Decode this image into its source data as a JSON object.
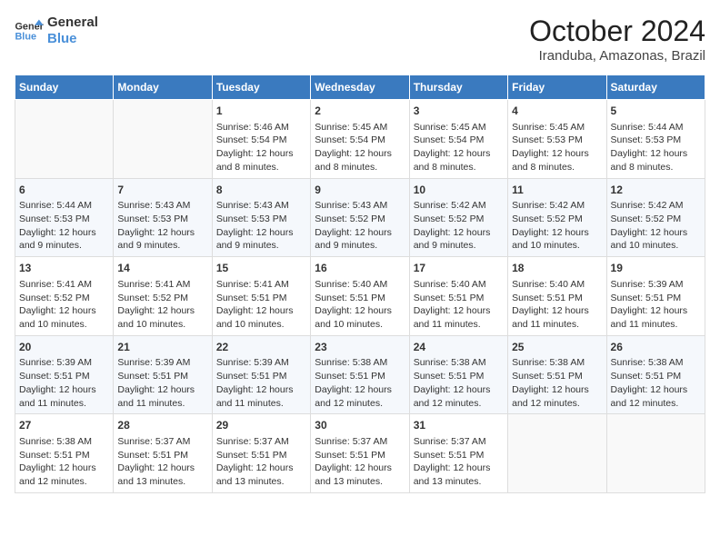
{
  "header": {
    "logo_line1": "General",
    "logo_line2": "Blue",
    "month": "October 2024",
    "location": "Iranduba, Amazonas, Brazil"
  },
  "weekdays": [
    "Sunday",
    "Monday",
    "Tuesday",
    "Wednesday",
    "Thursday",
    "Friday",
    "Saturday"
  ],
  "weeks": [
    [
      {
        "day": "",
        "info": ""
      },
      {
        "day": "",
        "info": ""
      },
      {
        "day": "1",
        "info": "Sunrise: 5:46 AM\nSunset: 5:54 PM\nDaylight: 12 hours and 8 minutes."
      },
      {
        "day": "2",
        "info": "Sunrise: 5:45 AM\nSunset: 5:54 PM\nDaylight: 12 hours and 8 minutes."
      },
      {
        "day": "3",
        "info": "Sunrise: 5:45 AM\nSunset: 5:54 PM\nDaylight: 12 hours and 8 minutes."
      },
      {
        "day": "4",
        "info": "Sunrise: 5:45 AM\nSunset: 5:53 PM\nDaylight: 12 hours and 8 minutes."
      },
      {
        "day": "5",
        "info": "Sunrise: 5:44 AM\nSunset: 5:53 PM\nDaylight: 12 hours and 8 minutes."
      }
    ],
    [
      {
        "day": "6",
        "info": "Sunrise: 5:44 AM\nSunset: 5:53 PM\nDaylight: 12 hours and 9 minutes."
      },
      {
        "day": "7",
        "info": "Sunrise: 5:43 AM\nSunset: 5:53 PM\nDaylight: 12 hours and 9 minutes."
      },
      {
        "day": "8",
        "info": "Sunrise: 5:43 AM\nSunset: 5:53 PM\nDaylight: 12 hours and 9 minutes."
      },
      {
        "day": "9",
        "info": "Sunrise: 5:43 AM\nSunset: 5:52 PM\nDaylight: 12 hours and 9 minutes."
      },
      {
        "day": "10",
        "info": "Sunrise: 5:42 AM\nSunset: 5:52 PM\nDaylight: 12 hours and 9 minutes."
      },
      {
        "day": "11",
        "info": "Sunrise: 5:42 AM\nSunset: 5:52 PM\nDaylight: 12 hours and 10 minutes."
      },
      {
        "day": "12",
        "info": "Sunrise: 5:42 AM\nSunset: 5:52 PM\nDaylight: 12 hours and 10 minutes."
      }
    ],
    [
      {
        "day": "13",
        "info": "Sunrise: 5:41 AM\nSunset: 5:52 PM\nDaylight: 12 hours and 10 minutes."
      },
      {
        "day": "14",
        "info": "Sunrise: 5:41 AM\nSunset: 5:52 PM\nDaylight: 12 hours and 10 minutes."
      },
      {
        "day": "15",
        "info": "Sunrise: 5:41 AM\nSunset: 5:51 PM\nDaylight: 12 hours and 10 minutes."
      },
      {
        "day": "16",
        "info": "Sunrise: 5:40 AM\nSunset: 5:51 PM\nDaylight: 12 hours and 10 minutes."
      },
      {
        "day": "17",
        "info": "Sunrise: 5:40 AM\nSunset: 5:51 PM\nDaylight: 12 hours and 11 minutes."
      },
      {
        "day": "18",
        "info": "Sunrise: 5:40 AM\nSunset: 5:51 PM\nDaylight: 12 hours and 11 minutes."
      },
      {
        "day": "19",
        "info": "Sunrise: 5:39 AM\nSunset: 5:51 PM\nDaylight: 12 hours and 11 minutes."
      }
    ],
    [
      {
        "day": "20",
        "info": "Sunrise: 5:39 AM\nSunset: 5:51 PM\nDaylight: 12 hours and 11 minutes."
      },
      {
        "day": "21",
        "info": "Sunrise: 5:39 AM\nSunset: 5:51 PM\nDaylight: 12 hours and 11 minutes."
      },
      {
        "day": "22",
        "info": "Sunrise: 5:39 AM\nSunset: 5:51 PM\nDaylight: 12 hours and 11 minutes."
      },
      {
        "day": "23",
        "info": "Sunrise: 5:38 AM\nSunset: 5:51 PM\nDaylight: 12 hours and 12 minutes."
      },
      {
        "day": "24",
        "info": "Sunrise: 5:38 AM\nSunset: 5:51 PM\nDaylight: 12 hours and 12 minutes."
      },
      {
        "day": "25",
        "info": "Sunrise: 5:38 AM\nSunset: 5:51 PM\nDaylight: 12 hours and 12 minutes."
      },
      {
        "day": "26",
        "info": "Sunrise: 5:38 AM\nSunset: 5:51 PM\nDaylight: 12 hours and 12 minutes."
      }
    ],
    [
      {
        "day": "27",
        "info": "Sunrise: 5:38 AM\nSunset: 5:51 PM\nDaylight: 12 hours and 12 minutes."
      },
      {
        "day": "28",
        "info": "Sunrise: 5:37 AM\nSunset: 5:51 PM\nDaylight: 12 hours and 13 minutes."
      },
      {
        "day": "29",
        "info": "Sunrise: 5:37 AM\nSunset: 5:51 PM\nDaylight: 12 hours and 13 minutes."
      },
      {
        "day": "30",
        "info": "Sunrise: 5:37 AM\nSunset: 5:51 PM\nDaylight: 12 hours and 13 minutes."
      },
      {
        "day": "31",
        "info": "Sunrise: 5:37 AM\nSunset: 5:51 PM\nDaylight: 12 hours and 13 minutes."
      },
      {
        "day": "",
        "info": ""
      },
      {
        "day": "",
        "info": ""
      }
    ]
  ]
}
